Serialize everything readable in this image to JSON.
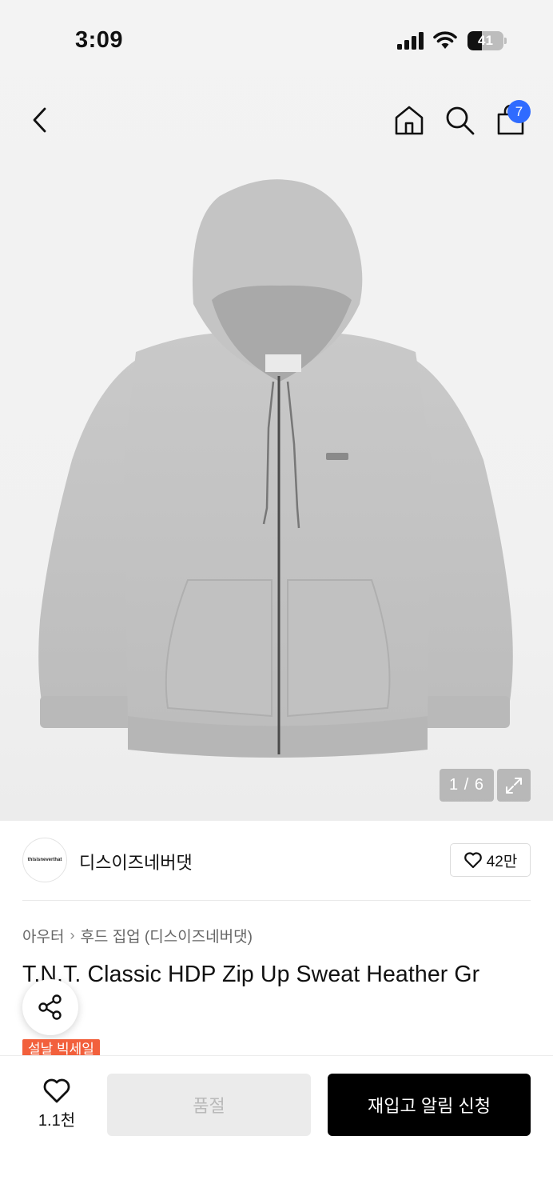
{
  "status_bar": {
    "time": "3:09",
    "battery_level": "41",
    "battery_fraction": 0.41,
    "icons": [
      "signal-icon",
      "wifi-icon",
      "battery-icon"
    ]
  },
  "header": {
    "icons": [
      "back-arrow-icon",
      "home-icon",
      "search-icon",
      "shopping-bag-icon"
    ],
    "cart_badge": "7"
  },
  "gallery": {
    "pager": "1 / 6",
    "expand_icon": "expand-icon"
  },
  "brand": {
    "logo_text": "thisisneverthat",
    "name": "디스이즈네버댓",
    "likes": "42만",
    "like_icon": "heart-outline-icon"
  },
  "breadcrumb": {
    "category": "아우터",
    "separator": "›",
    "subcategory": "후드 집업 (디스이즈네버댓)"
  },
  "product": {
    "title": "T.N.T. Classic HDP Zip Up Sweat Heather Gr",
    "sale_badge": "설날 빅세일",
    "share_icon": "share-icon"
  },
  "bottom_bar": {
    "wish_count": "1.1천",
    "soldout_label": "품절",
    "restock_label": "재입고 알림 신청"
  },
  "colors": {
    "accent_blue": "#2f6bff",
    "sale_orange": "#f2603c",
    "primary_black": "#000000",
    "disabled_gray": "#ebebeb"
  }
}
